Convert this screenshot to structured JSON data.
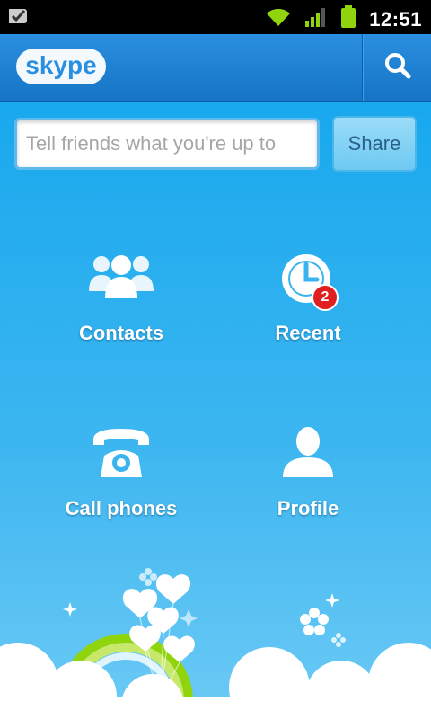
{
  "status_bar": {
    "time": "12:51"
  },
  "app": {
    "logo_text": "skype",
    "search_icon": "search-icon"
  },
  "mood": {
    "placeholder": "Tell friends what you're up to",
    "value": ""
  },
  "share_label": "Share",
  "tiles": {
    "contacts": {
      "label": "Contacts",
      "icon": "contacts-icon"
    },
    "recent": {
      "label": "Recent",
      "icon": "clock-icon",
      "badge": "2"
    },
    "call_phones": {
      "label": "Call phones",
      "icon": "phone-icon"
    },
    "profile": {
      "label": "Profile",
      "icon": "profile-icon"
    }
  },
  "colors": {
    "appbar": "#1e82d6",
    "background_top": "#18a8ee",
    "background_bottom": "#6ccaf5",
    "badge": "#e02020"
  }
}
